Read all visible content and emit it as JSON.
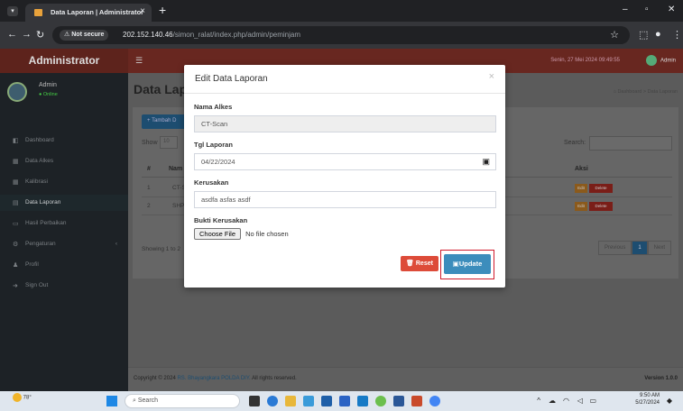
{
  "browser": {
    "tab_title": "Data Laporan | Administrator",
    "tab_close": "×",
    "new_tab": "+",
    "not_secure": "Not secure",
    "url_host": "202.152.140.46",
    "url_path": "/simon_ralat/index.php/admin/peminjam"
  },
  "app": {
    "brand": "Administrator",
    "datetime": "Senin, 27 Mei 2024 09:49:55",
    "admin_label": "Admin",
    "user": {
      "name": "Admin",
      "status": "Online"
    },
    "sidebar": {
      "items": [
        {
          "label": "Dashboard"
        },
        {
          "label": "Data Alkes"
        },
        {
          "label": "Kalibrasi"
        },
        {
          "label": "Data Laporan"
        },
        {
          "label": "Hasil Perbaikan"
        },
        {
          "label": "Pengaturan"
        },
        {
          "label": "Profil"
        },
        {
          "label": "Sign Out"
        }
      ]
    },
    "page_title": "Data Lapo",
    "breadcrumb": {
      "home": "Dashboard",
      "separator": ">",
      "current": "Data Laporan"
    },
    "add_button": "+ Tambah D",
    "show_label": "Show",
    "show_value": "10",
    "search_label": "Search:",
    "table": {
      "headers": [
        "#",
        "Nam",
        "Aksi"
      ],
      "rows": [
        {
          "no": "1",
          "name": "CT-S"
        },
        {
          "no": "2",
          "name": "SHP"
        }
      ],
      "edit_label": "Edit",
      "delete_label": "Delete"
    },
    "showing_text": "Showing 1 to 2",
    "pager": {
      "prev": "Previous",
      "current": "1",
      "next": "Next"
    },
    "footer": {
      "copyright_prefix": "Copyright © 2024",
      "copyright_link": "RS. Bhayangkara POLDA DIY.",
      "copyright_suffix": "All rights reserved.",
      "version_label": "Version",
      "version_value": "1.0.0"
    }
  },
  "modal": {
    "title": "Edit Data Laporan",
    "close": "×",
    "nama_alkes_label": "Nama Alkes",
    "nama_alkes_value": "CT-Scan",
    "tgl_label": "Tgl Laporan",
    "tgl_value": "04/22/2024",
    "kerusakan_label": "Kerusakan",
    "kerusakan_value": "asdfa asfas asdf",
    "bukti_label": "Bukti Kerusakan",
    "file_button": "Choose File",
    "file_status": "No file chosen",
    "reset_label": "Reset",
    "update_label": "Update"
  },
  "taskbar": {
    "weather_temp": "78°",
    "search_placeholder": "Search",
    "time": "9:50 AM",
    "date": "5/27/2024"
  },
  "colors": {
    "modal_primary": "#3c8dbc",
    "modal_danger": "#dd4b39",
    "highlight_outline": "#d01a2c",
    "header_bg": "#682720"
  }
}
